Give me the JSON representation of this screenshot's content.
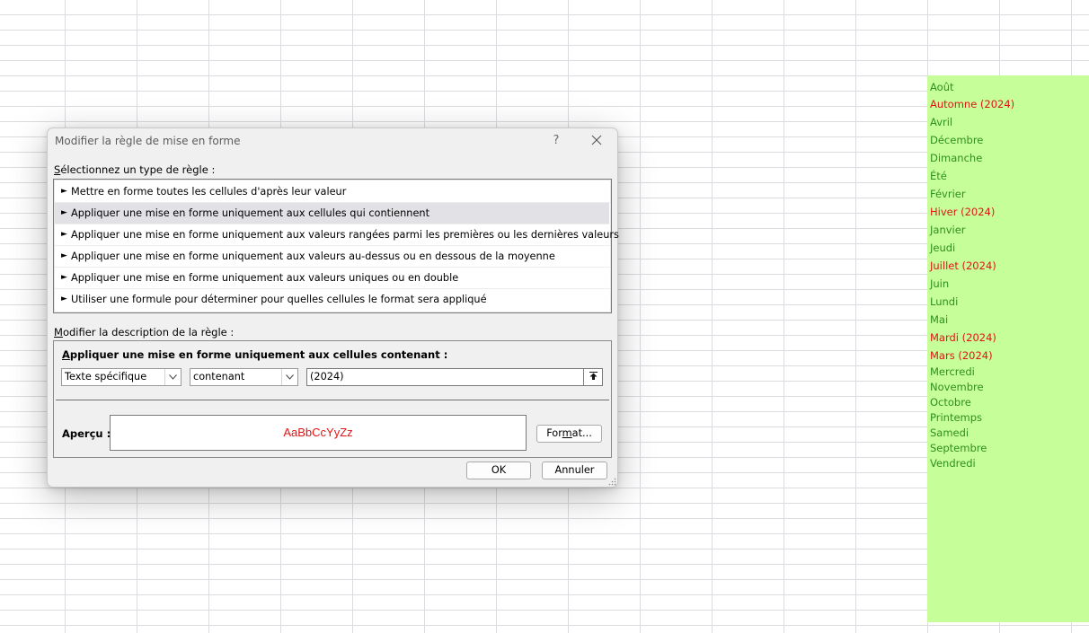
{
  "dialog": {
    "title": "Modifier la règle de mise en forme",
    "help_label": "?",
    "select_rule_type": {
      "accesskey": "S",
      "rest": "électionnez un type de règle :"
    },
    "rule_types": [
      "Mettre en forme toutes les cellules d'après leur valeur",
      "Appliquer une mise en forme uniquement aux cellules qui contiennent",
      "Appliquer une mise en forme uniquement aux valeurs rangées parmi les premières ou les dernières valeurs",
      "Appliquer une mise en forme uniquement aux valeurs au-dessus ou en dessous de la moyenne",
      "Appliquer une mise en forme uniquement aux valeurs uniques ou en double",
      "Utiliser une formule pour déterminer pour quelles cellules le format sera appliqué"
    ],
    "rule_arrow_glyph": "►",
    "selected_rule_index": 1,
    "edit_description": {
      "accesskey": "M",
      "rest": "odifier la description de la règle :"
    },
    "description_heading": {
      "accesskey": "A",
      "rest": "ppliquer une mise en forme uniquement aux cellules contenant :"
    },
    "condition_type": "Texte spécifique",
    "operator": "contenant",
    "value": "(2024)",
    "preview_label": "Aperçu :",
    "preview_sample": "AaBbCcYyZz",
    "preview_color": "#e01515",
    "format_button": {
      "before": "For",
      "accesskey": "m",
      "after": "at..."
    },
    "ok_label": "OK",
    "cancel_label": "Annuler"
  },
  "spreadsheet": {
    "fill_color": "#c6ff99",
    "cells": [
      {
        "text": "Août",
        "color": "green"
      },
      {
        "text": "Automne (2024)",
        "color": "red"
      },
      {
        "text": "Avril",
        "color": "green"
      },
      {
        "text": "Décembre",
        "color": "green"
      },
      {
        "text": "Dimanche",
        "color": "green"
      },
      {
        "text": "Été",
        "color": "green"
      },
      {
        "text": "Février",
        "color": "green"
      },
      {
        "text": "Hiver (2024)",
        "color": "red"
      },
      {
        "text": "Janvier",
        "color": "green"
      },
      {
        "text": "Jeudi",
        "color": "green"
      },
      {
        "text": "Juillet (2024)",
        "color": "red"
      },
      {
        "text": "Juin",
        "color": "green"
      },
      {
        "text": "Lundi",
        "color": "green"
      },
      {
        "text": "Mai",
        "color": "green"
      },
      {
        "text": "Mardi (2024)",
        "color": "red"
      },
      {
        "text": "Mars (2024)",
        "color": "red"
      },
      {
        "text": "Mercredi",
        "color": "green"
      },
      {
        "text": "Novembre",
        "color": "green"
      },
      {
        "text": "Octobre",
        "color": "green"
      },
      {
        "text": "Printemps",
        "color": "green"
      },
      {
        "text": "Samedi",
        "color": "green"
      },
      {
        "text": "Septembre",
        "color": "green"
      },
      {
        "text": "Vendredi",
        "color": "green"
      }
    ]
  }
}
